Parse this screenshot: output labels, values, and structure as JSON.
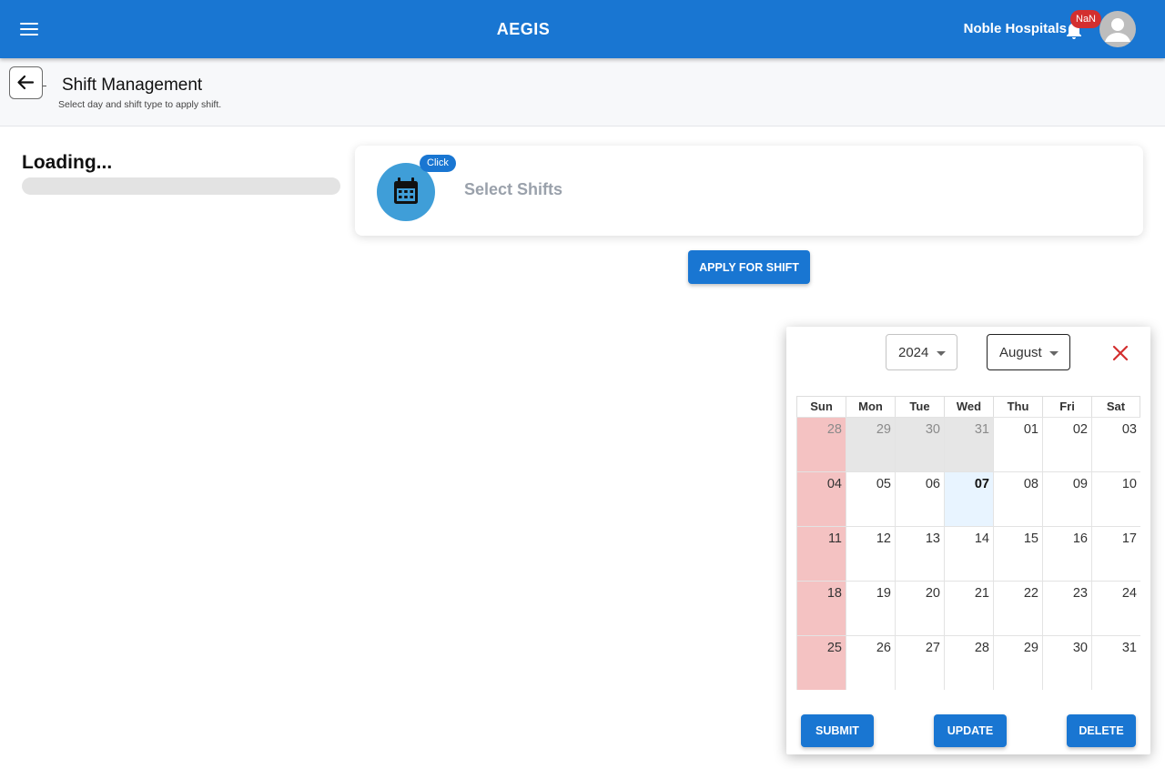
{
  "header": {
    "title": "AEGIS",
    "organization": "Noble Hospitals",
    "notification_badge": "NaN",
    "menu_icon": "hamburger-menu-icon",
    "bell_icon": "notification-bell-icon",
    "avatar_icon": "account-avatar-icon",
    "color": "#1976d2"
  },
  "subheader": {
    "title": "Shift Management",
    "subtitle": "Select day and shift type to apply shift.",
    "back_icon": "arrow-left-icon"
  },
  "left_panel": {
    "loading_text": "Loading..."
  },
  "shift_card": {
    "chip_label": "Click",
    "label": "Select Shifts",
    "icon": "calendar-icon"
  },
  "apply_button": "APPLY FOR SHIFT",
  "calendar": {
    "year": "2024",
    "month": "August",
    "close_icon": "close-icon",
    "weekdays": [
      "Sun",
      "Mon",
      "Tue",
      "Wed",
      "Thu",
      "Fri",
      "Sat"
    ],
    "weeks": [
      [
        "28",
        "29",
        "30",
        "31",
        "01",
        "02",
        "03"
      ],
      [
        "04",
        "05",
        "06",
        "07",
        "08",
        "09",
        "10"
      ],
      [
        "11",
        "12",
        "13",
        "14",
        "15",
        "16",
        "17"
      ],
      [
        "18",
        "19",
        "20",
        "21",
        "22",
        "23",
        "24"
      ],
      [
        "25",
        "26",
        "27",
        "28",
        "29",
        "30",
        "31"
      ]
    ],
    "previous_month_days": 4,
    "today": "07",
    "sunday_color": "#f4c2c2",
    "today_color": "#e8f4ff",
    "actions": {
      "submit": "SUBMIT",
      "update": "UPDATE",
      "delete": "DELETE"
    }
  }
}
